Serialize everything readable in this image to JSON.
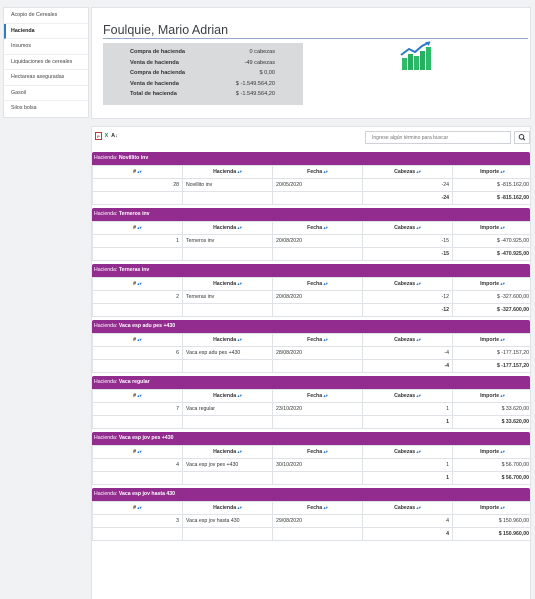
{
  "sidebar": {
    "items": [
      {
        "label": "Acopio de Cereales",
        "active": false
      },
      {
        "label": "Hacienda",
        "active": true
      },
      {
        "label": "Insumos",
        "active": false
      },
      {
        "label": "Liquidaciones de cereales",
        "active": false
      },
      {
        "label": "Hectareas aseguradas",
        "active": false
      },
      {
        "label": "Gasoil",
        "active": false
      },
      {
        "label": "Silos bolsa",
        "active": false
      }
    ]
  },
  "header": {
    "title": "Foulquie, Mario Adrian",
    "summary": [
      {
        "label": "Compra de hacienda",
        "value": "0 cabezas"
      },
      {
        "label": "Venta de hacienda",
        "value": "-49 cabezas"
      },
      {
        "label": "Compra de hacienda",
        "value": "$ 0,00"
      },
      {
        "label": "Venta de hacienda",
        "value": "$ -1.549.564,20"
      },
      {
        "label": "Total de hacienda",
        "value": "$ -1.549.564,20"
      }
    ]
  },
  "search": {
    "placeholder": "Ingrese algún término para buscar"
  },
  "columns": [
    "#",
    "Hacienda",
    "Fecha",
    "Cabezas",
    "Importe"
  ],
  "groups": [
    {
      "prefix": "Hacienda: ",
      "name": "Novillito inv",
      "rows": [
        {
          "id": "28",
          "hacienda": "Novillito inv",
          "fecha": "20/05/2020",
          "cabezas": "-24",
          "importe": "$ -815.162,00"
        }
      ],
      "total_cabezas": "-24",
      "total_importe": "$ -815.162,00"
    },
    {
      "prefix": "Hacienda: ",
      "name": "Terneros inv",
      "rows": [
        {
          "id": "1",
          "hacienda": "Terneros inv",
          "fecha": "20/08/2020",
          "cabezas": "-15",
          "importe": "$ -470.925,00"
        }
      ],
      "total_cabezas": "-15",
      "total_importe": "$ -470.925,00"
    },
    {
      "prefix": "Hacienda: ",
      "name": "Terneras inv",
      "rows": [
        {
          "id": "2",
          "hacienda": "Terneras inv",
          "fecha": "20/08/2020",
          "cabezas": "-12",
          "importe": "$ -327.600,00"
        }
      ],
      "total_cabezas": "-12",
      "total_importe": "$ -327.600,00"
    },
    {
      "prefix": "Hacienda: ",
      "name": "Vaca esp adu pes +430",
      "rows": [
        {
          "id": "6",
          "hacienda": "Vaca esp adu pes +430",
          "fecha": "28/08/2020",
          "cabezas": "-4",
          "importe": "$ -177.157,20"
        }
      ],
      "total_cabezas": "-4",
      "total_importe": "$ -177.157,20"
    },
    {
      "prefix": "Hacienda: ",
      "name": "Vaca regular",
      "rows": [
        {
          "id": "7",
          "hacienda": "Vaca regular",
          "fecha": "23/10/2020",
          "cabezas": "1",
          "importe": "$ 33.620,00"
        }
      ],
      "total_cabezas": "1",
      "total_importe": "$ 33.620,00"
    },
    {
      "prefix": "Hacienda: ",
      "name": "Vaca esp jov pes +430",
      "rows": [
        {
          "id": "4",
          "hacienda": "Vaca esp jov pes +430",
          "fecha": "30/10/2020",
          "cabezas": "1",
          "importe": "$ 56.700,00"
        }
      ],
      "total_cabezas": "1",
      "total_importe": "$ 56.700,00"
    },
    {
      "prefix": "Hacienda: ",
      "name": "Vaca esp jov hasta 430",
      "rows": [
        {
          "id": "3",
          "hacienda": "Vaca esp jov hasta 430",
          "fecha": "29/08/2020",
          "cabezas": "4",
          "importe": "$ 150.960,00"
        }
      ],
      "total_cabezas": "4",
      "total_importe": "$ 150.960,00"
    }
  ],
  "colors": {
    "group_header": "#922c8e",
    "accent": "#2e79c9",
    "chart_green": "#2dbb6a",
    "chart_arrow": "#2e79c9"
  },
  "icons": [
    "pdf-icon",
    "excel-icon",
    "sort-icon",
    "search-icon",
    "growth-chart-icon"
  ]
}
